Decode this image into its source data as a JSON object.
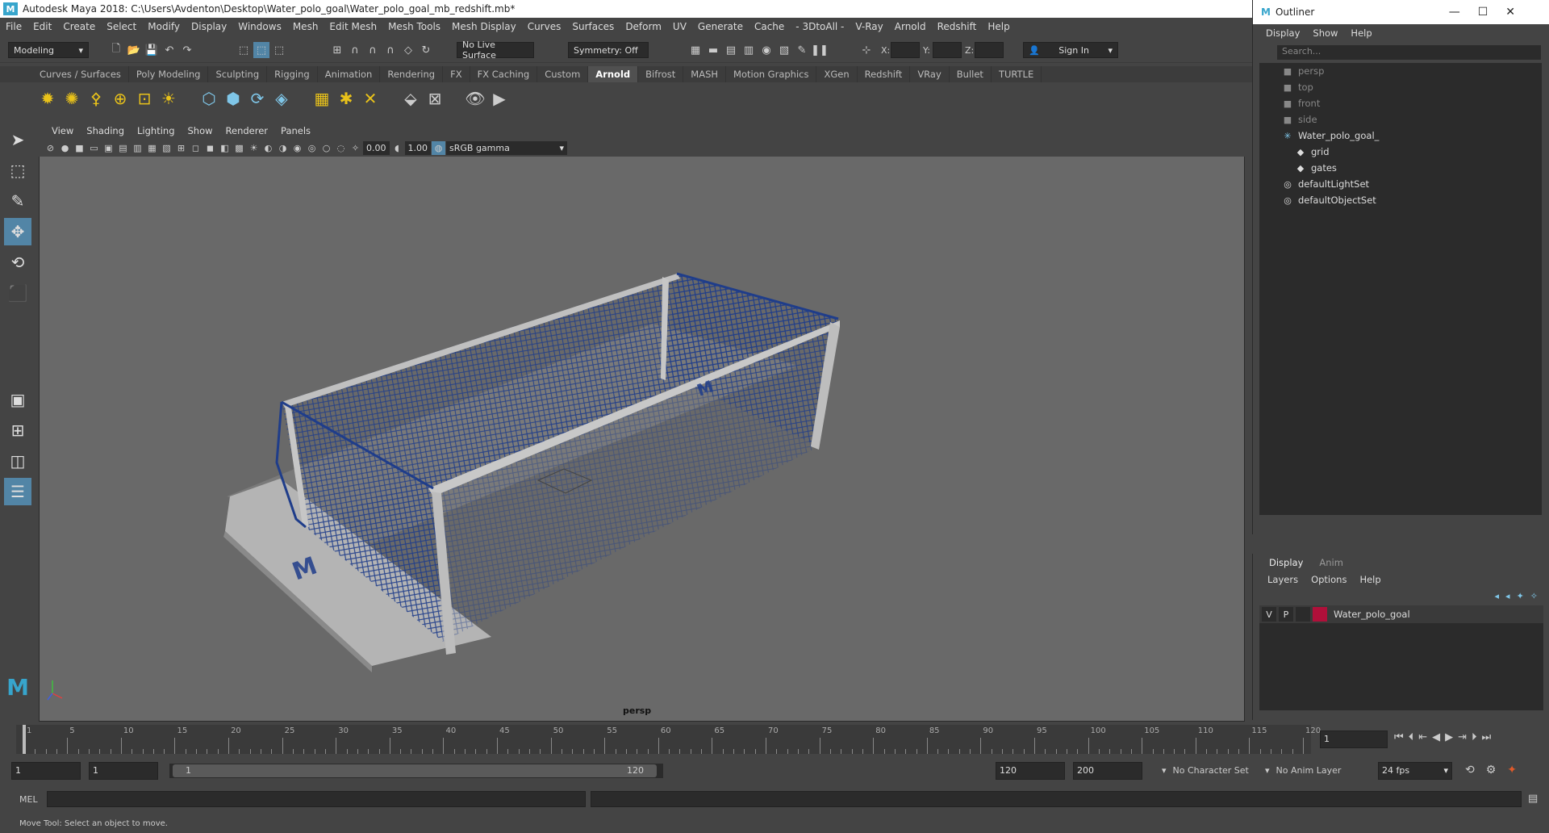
{
  "window": {
    "title": "Autodesk Maya 2018: C:\\Users\\Avdenton\\Desktop\\Water_polo_goal\\Water_polo_goal_mb_redshift.mb*"
  },
  "menubar": [
    "File",
    "Edit",
    "Create",
    "Select",
    "Modify",
    "Display",
    "Windows",
    "Mesh",
    "Edit Mesh",
    "Mesh Tools",
    "Mesh Display",
    "Curves",
    "Surfaces",
    "Deform",
    "UV",
    "Generate",
    "Cache",
    "- 3DtoAll -",
    "V-Ray",
    "Arnold",
    "Redshift",
    "Help"
  ],
  "statusline": {
    "mode": "Modeling",
    "live_surface": "No Live Surface",
    "symmetry": "Symmetry: Off",
    "x_label": "X:",
    "y_label": "Y:",
    "z_label": "Z:",
    "sign_in": "Sign In"
  },
  "shelf_tabs": [
    "Curves / Surfaces",
    "Poly Modeling",
    "Sculpting",
    "Rigging",
    "Animation",
    "Rendering",
    "FX",
    "FX Caching",
    "Custom",
    "Arnold",
    "Bifrost",
    "MASH",
    "Motion Graphics",
    "XGen",
    "Redshift",
    "VRay",
    "Bullet",
    "TURTLE"
  ],
  "active_shelf": "Arnold",
  "viewport": {
    "menu": [
      "View",
      "Shading",
      "Lighting",
      "Show",
      "Renderer",
      "Panels"
    ],
    "exposure": "0.00",
    "gamma": "1.00",
    "color_space": "sRGB gamma",
    "camera": "persp"
  },
  "outliner": {
    "title": "Outliner",
    "menu": [
      "Display",
      "Show",
      "Help"
    ],
    "search_placeholder": "Search...",
    "items": [
      {
        "label": "persp",
        "icon": "camera-icon",
        "dim": true,
        "indent": 0
      },
      {
        "label": "top",
        "icon": "camera-icon",
        "dim": true,
        "indent": 0
      },
      {
        "label": "front",
        "icon": "camera-icon",
        "dim": true,
        "indent": 0
      },
      {
        "label": "side",
        "icon": "camera-icon",
        "dim": true,
        "indent": 0
      },
      {
        "label": "Water_polo_goal_",
        "icon": "group-icon",
        "dim": false,
        "indent": 0
      },
      {
        "label": "grid",
        "icon": "mesh-icon",
        "dim": false,
        "indent": 1
      },
      {
        "label": "gates",
        "icon": "mesh-icon",
        "dim": false,
        "indent": 1
      },
      {
        "label": "defaultLightSet",
        "icon": "set-icon",
        "dim": false,
        "indent": 0
      },
      {
        "label": "defaultObjectSet",
        "icon": "set-icon",
        "dim": false,
        "indent": 0
      }
    ]
  },
  "layers": {
    "tabs": [
      "Display",
      "Anim"
    ],
    "menu": [
      "Layers",
      "Options",
      "Help"
    ],
    "rows": [
      {
        "v": "V",
        "p": "P",
        "name": "Water_polo_goal",
        "color": "#b0103a"
      }
    ]
  },
  "timeline": {
    "ticks": [
      1,
      5,
      10,
      15,
      20,
      25,
      30,
      35,
      40,
      45,
      50,
      55,
      60,
      65,
      70,
      75,
      80,
      85,
      90,
      95,
      100,
      105,
      110,
      115,
      120
    ],
    "current_frame": "1"
  },
  "range": {
    "start": "1",
    "anim_start": "1",
    "range_start": "1",
    "range_end": "120",
    "anim_end": "120",
    "end": "200",
    "character_set": "No Character Set",
    "anim_layer": "No Anim Layer",
    "fps": "24 fps"
  },
  "cmd": {
    "label": "MEL"
  },
  "help_line": "Move Tool: Select an object to move."
}
